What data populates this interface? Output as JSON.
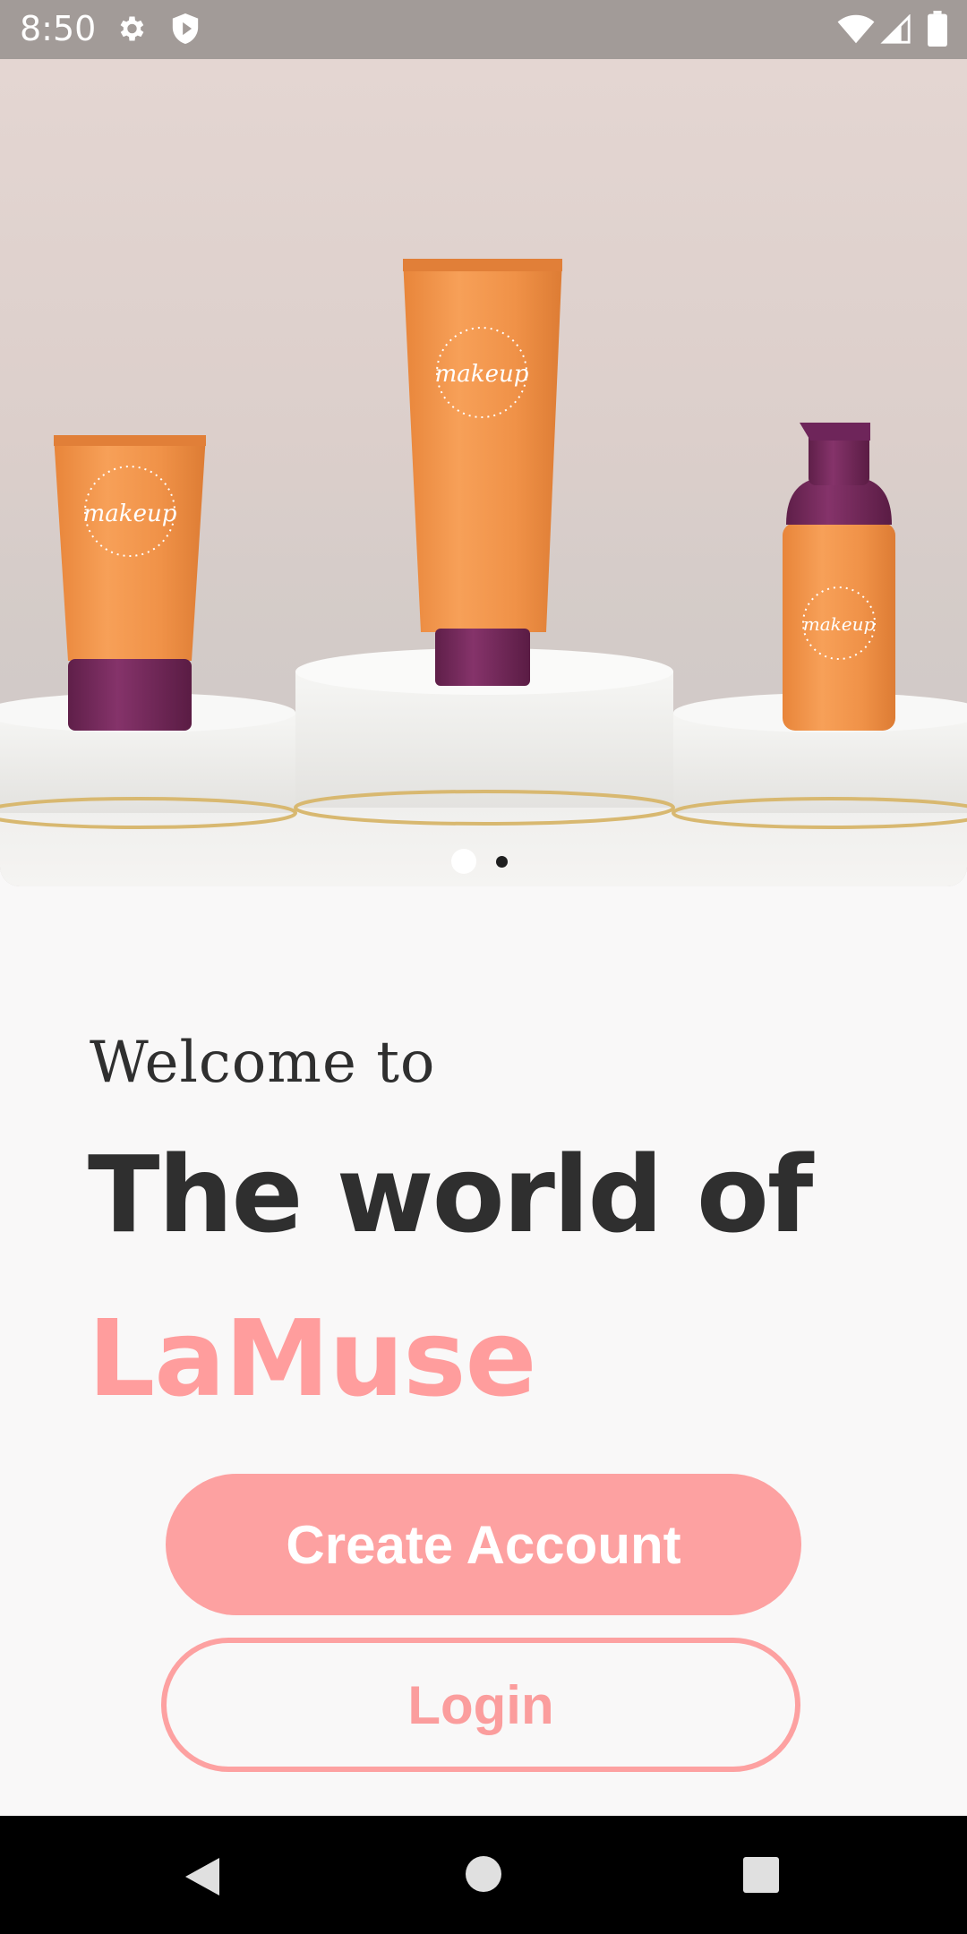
{
  "status_bar": {
    "time": "8:50",
    "icons": [
      "gear-icon",
      "shield-icon",
      "wifi-icon",
      "signal-icon",
      "battery-icon"
    ]
  },
  "hero": {
    "carousel": {
      "total_pages": 2,
      "active_page": 1
    },
    "colors": {
      "tube_orange": "#f0944a",
      "cap_purple": "#7a2a5e",
      "podium": "#eeeeec",
      "gold_trim": "#d8b870"
    }
  },
  "welcome": {
    "intro": "Welcome to",
    "headline": "The world of",
    "brand": "LaMuse"
  },
  "actions": {
    "create_account_label": "Create Account",
    "login_label": "Login"
  },
  "nav_bar": {
    "icons": [
      "back-icon",
      "home-icon",
      "recents-icon"
    ]
  },
  "colors": {
    "accent": "#fda1a1",
    "text_dark": "#2f2f2f",
    "status_bar": "#a29b98",
    "background": "#f9f8f8"
  }
}
